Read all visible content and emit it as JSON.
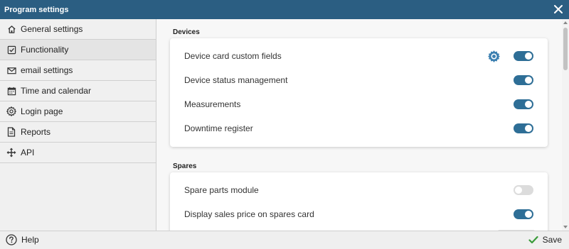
{
  "window": {
    "title": "Program settings",
    "close_icon": "close-icon"
  },
  "sidebar": {
    "items": [
      {
        "label": "General settings",
        "icon": "home-icon"
      },
      {
        "label": "Functionality",
        "icon": "checkbox-icon",
        "active": true
      },
      {
        "label": "email settings",
        "icon": "envelope-icon"
      },
      {
        "label": "Time and calendar",
        "icon": "calendar-icon"
      },
      {
        "label": "Login page",
        "icon": "gear-icon"
      },
      {
        "label": "Reports",
        "icon": "document-icon"
      },
      {
        "label": "API",
        "icon": "move-arrows-icon"
      }
    ]
  },
  "main": {
    "sections": [
      {
        "title": "Devices",
        "rows": [
          {
            "label": "Device card custom fields",
            "enabled": true,
            "has_settings_icon": true
          },
          {
            "label": "Device status management",
            "enabled": true
          },
          {
            "label": "Measurements",
            "enabled": true
          },
          {
            "label": "Downtime register",
            "enabled": true
          }
        ]
      },
      {
        "title": "Spares",
        "rows": [
          {
            "label": "Spare parts module",
            "enabled": false
          },
          {
            "label": "Display sales price on spares card",
            "enabled": true
          }
        ]
      }
    ]
  },
  "footer": {
    "help_label": "Help",
    "save_label": "Save"
  },
  "colors": {
    "titlebar": "#2b5e82",
    "toggle_on": "#2e6e96",
    "toggle_off": "#dcdcdc",
    "save_check": "#3a9b3a"
  }
}
